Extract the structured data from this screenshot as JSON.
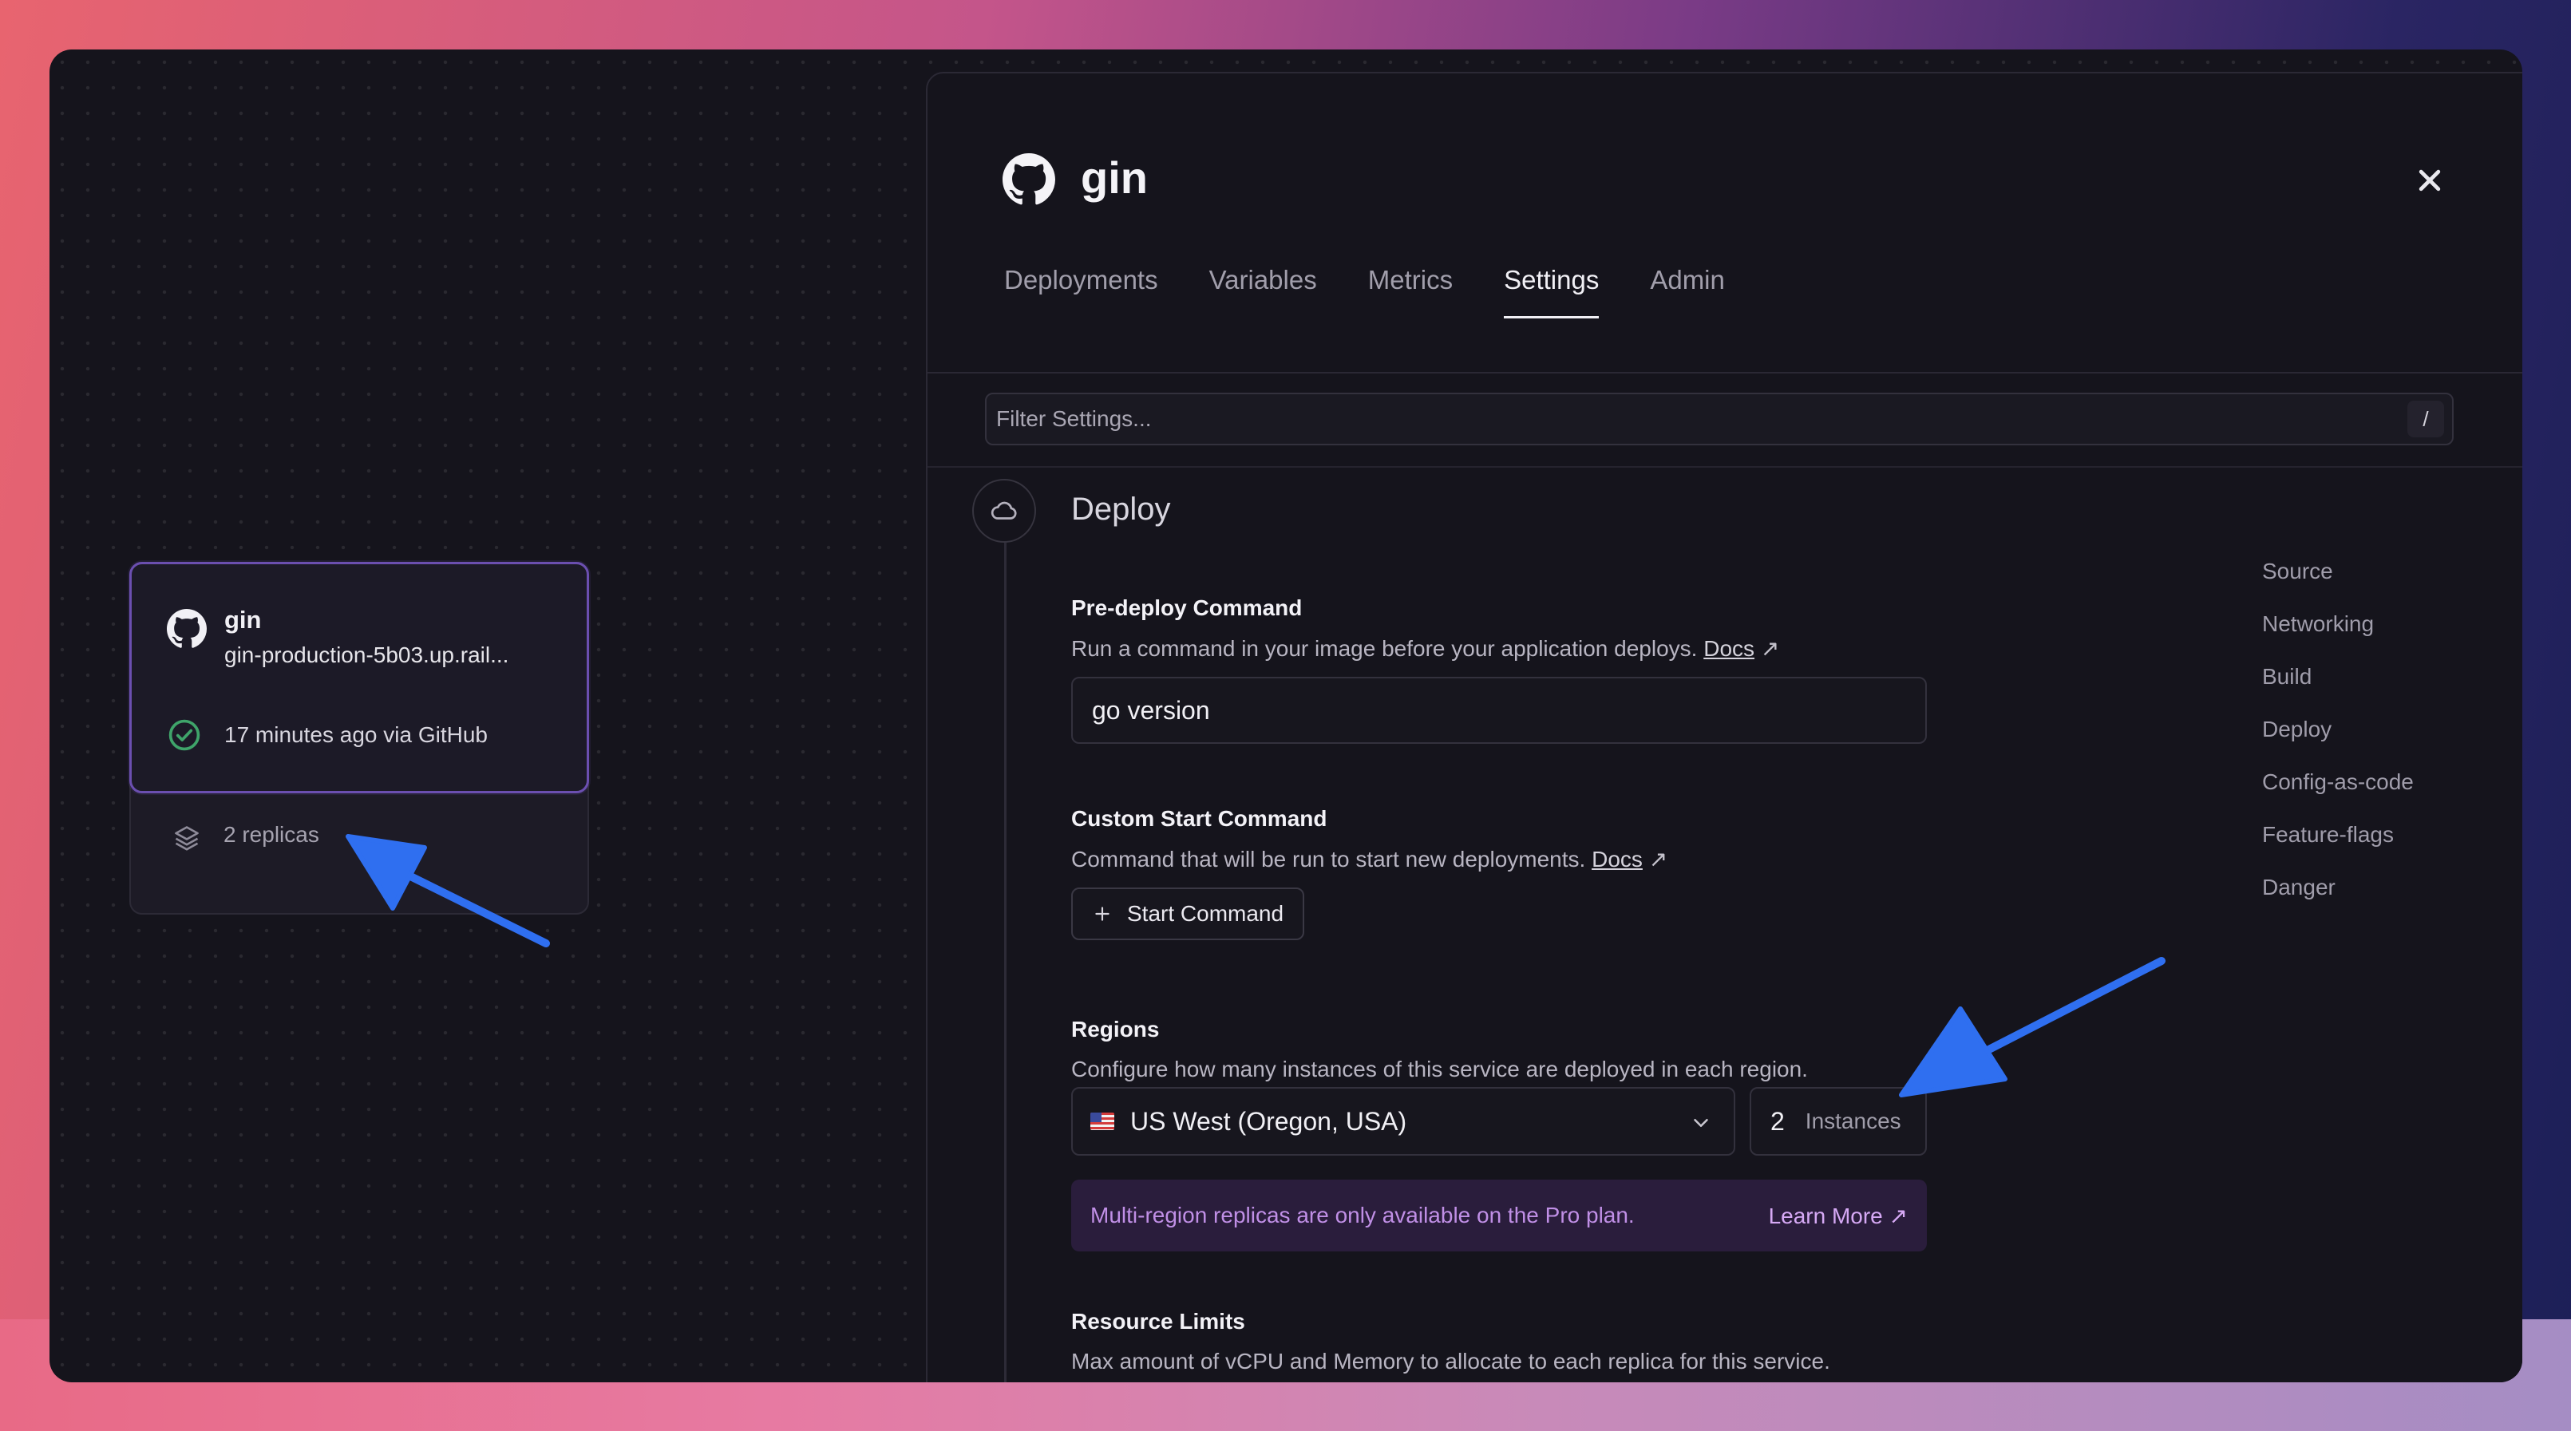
{
  "canvas": {
    "card": {
      "title": "gin",
      "url": "gin-production-5b03.up.rail...",
      "status": "17 minutes ago via GitHub",
      "replicas": "2 replicas"
    }
  },
  "panel": {
    "title": "gin",
    "tabs": [
      {
        "label": "Deployments"
      },
      {
        "label": "Variables"
      },
      {
        "label": "Metrics"
      },
      {
        "label": "Settings"
      },
      {
        "label": "Admin"
      }
    ],
    "active_tab": "Settings",
    "filter": {
      "placeholder": "Filter Settings...",
      "shortcut": "/"
    },
    "section_title": "Deploy",
    "predeploy": {
      "label": "Pre-deploy Command",
      "desc": "Run a command in your image before your application deploys.",
      "docs": "Docs",
      "ext": "↗",
      "value": "go version"
    },
    "start": {
      "label": "Custom Start Command",
      "desc": "Command that will be run to start new deployments.",
      "docs": "Docs",
      "ext": "↗",
      "button": "Start Command"
    },
    "regions": {
      "label": "Regions",
      "desc": "Configure how many instances of this service are deployed in each region.",
      "region": "US West (Oregon, USA)",
      "instances": "2",
      "instances_unit": "Instances",
      "banner_msg": "Multi-region replicas are only available on the Pro plan.",
      "banner_link": "Learn More ↗"
    },
    "resources": {
      "label": "Resource Limits",
      "desc": "Max amount of vCPU and Memory to allocate to each replica for this service."
    },
    "side_nav": [
      {
        "label": "Source"
      },
      {
        "label": "Networking"
      },
      {
        "label": "Build"
      },
      {
        "label": "Deploy"
      },
      {
        "label": "Config-as-code"
      },
      {
        "label": "Feature-flags"
      },
      {
        "label": "Danger"
      }
    ]
  },
  "colors": {
    "accent_border": "#6b4fb0",
    "banner_bg": "#2a1d3c",
    "banner_text": "#c08fe6",
    "arrow": "#2f6ff0",
    "success": "#3fa46a"
  },
  "icons": [
    "github-icon",
    "check-circle-icon",
    "layers-icon",
    "close-icon",
    "cloud-icon",
    "plus-icon",
    "chevron-down-icon",
    "us-flag-icon",
    "slash-key-icon"
  ]
}
